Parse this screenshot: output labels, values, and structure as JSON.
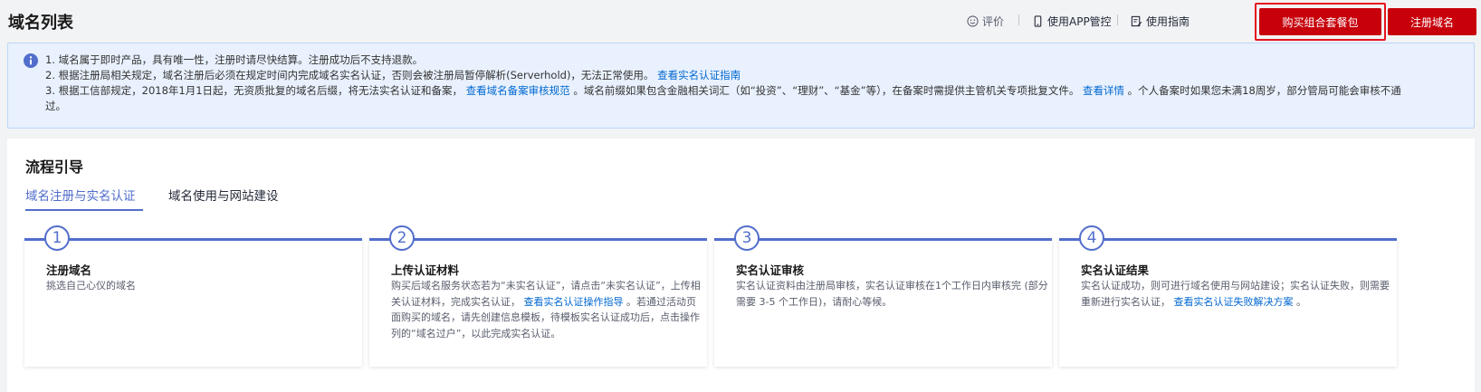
{
  "header": {
    "title": "域名列表",
    "links": {
      "rate": "评价",
      "app": "使用APP管控",
      "guide": "使用指南"
    },
    "buttons": {
      "buy_package": "购买组合套餐包",
      "register_domain": "注册域名"
    }
  },
  "notice": {
    "line1": "1. 域名属于即时产品，具有唯一性，注册时请尽快结算。注册成功后不支持退款。",
    "line2_text": "2. 根据注册局相关规定，域名注册后必须在规定时间内完成域名实名认证，否则会被注册局暂停解析(Serverhold)，无法正常使用。",
    "line2_link": "查看实名认证指南",
    "line3_text_a": "3. 根据工信部规定，2018年1月1日起，无资质批复的域名后缀，将无法实名认证和备案，",
    "line3_link_a": "查看域名备案审核规范",
    "line3_text_b": "。域名前缀如果包含金融相关词汇（如“投资”、“理财”、“基金”等），在备案时需提供主管机关专项批复文件。",
    "line3_link_b": "查看详情",
    "line3_text_c": "。个人备案时如果您未满18周岁，部分管局可能会审核不通",
    "line4": "过。"
  },
  "guide": {
    "title": "流程引导",
    "tabs": [
      "域名注册与实名认证",
      "域名使用与网站建设"
    ],
    "steps": [
      {
        "number": "1",
        "title": "注册域名",
        "desc": "挑选自己心仪的域名"
      },
      {
        "number": "2",
        "title": "上传认证材料",
        "desc_a": "购买后域名服务状态若为“未实名认证”，请点击“未实名认证”，上传相关认证材料，完成实名认证，",
        "link": "查看实名认证操作指导",
        "desc_b": "。若通过活动页面购买的域名，请先创建信息模板，待模板实名认证成功后，点击操作列的“域名过户”，以此完成实名认证。"
      },
      {
        "number": "3",
        "title": "实名认证审核",
        "desc": "实名认证资料由注册局审核，实名认证审核在1个工作日内审核完 (部分需要 3-5 个工作日)，请耐心等候。"
      },
      {
        "number": "4",
        "title": "实名认证结果",
        "desc_a": "实名认证成功，则可进行域名使用与网站建设；实名认证失败，则需要重新进行实名认证，",
        "link": "查看实名认证失败解决方案",
        "desc_b": "。"
      }
    ]
  },
  "colors": {
    "brand_red": "#c7000b",
    "accent_blue": "#526ecc",
    "link_blue": "#0067d1",
    "notice_bg": "#e8f1fd"
  },
  "icons": [
    "smile-icon",
    "phone-icon",
    "edit-note-icon",
    "info-icon"
  ]
}
